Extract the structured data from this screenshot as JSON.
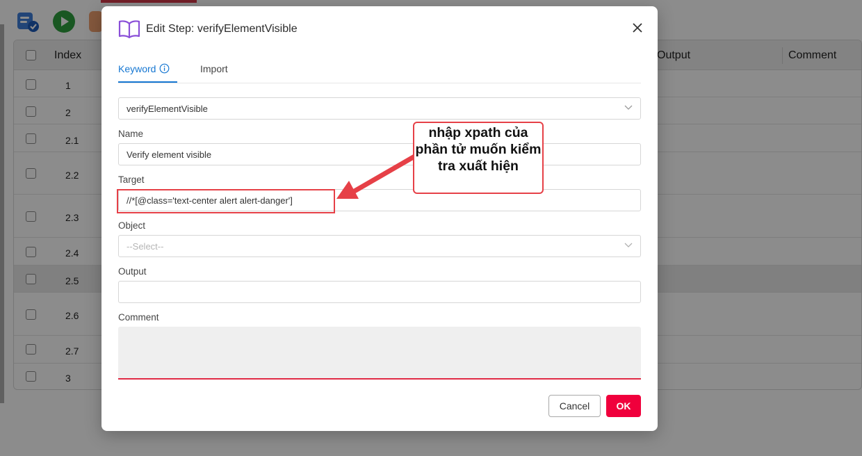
{
  "background": {
    "grid": {
      "headers": {
        "index": "Index",
        "output": "Output",
        "comment": "Comment"
      },
      "rows": [
        {
          "index": "1",
          "selected": false
        },
        {
          "index": "2",
          "selected": false
        },
        {
          "index": "2.1",
          "selected": false
        },
        {
          "index": "2.2",
          "selected": false
        },
        {
          "index": "2.3",
          "selected": false
        },
        {
          "index": "2.4",
          "selected": false
        },
        {
          "index": "2.5",
          "selected": true
        },
        {
          "index": "2.6",
          "selected": false
        },
        {
          "index": "2.7",
          "selected": false
        },
        {
          "index": "3",
          "selected": false
        }
      ]
    }
  },
  "modal": {
    "title": "Edit Step: verifyElementVisible",
    "tabs": {
      "keyword": "Keyword",
      "import": "Import"
    },
    "keyword_select": "verifyElementVisible",
    "name_label": "Name",
    "name_value": "Verify element visible",
    "target_label": "Target",
    "target_value": "//*[@class='text-center alert alert-danger']",
    "object_label": "Object",
    "object_placeholder": "--Select--",
    "output_label": "Output",
    "output_value": "",
    "comment_label": "Comment",
    "comment_value": "",
    "cancel_label": "Cancel",
    "ok_label": "OK"
  },
  "annotation": {
    "callout_text": "nhập xpath của phần tử muốn kiểm tra xuất hiện"
  },
  "colors": {
    "accent_blue": "#1677d2",
    "ok_red": "#f0003c",
    "annotation_red": "#e64047"
  }
}
